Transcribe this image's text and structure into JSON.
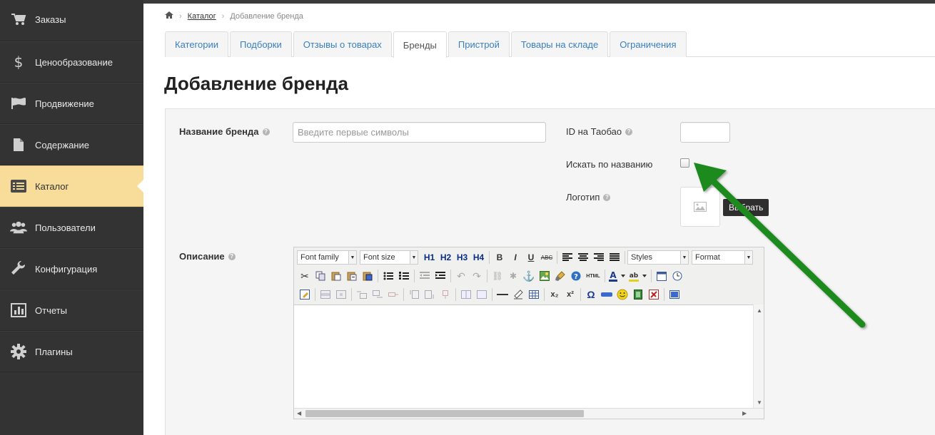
{
  "sidebar": {
    "items": [
      {
        "label": "Заказы",
        "icon": "cart-icon",
        "active": false
      },
      {
        "label": "Ценообразование",
        "icon": "dollar-icon",
        "active": false
      },
      {
        "label": "Продвижение",
        "icon": "flag-icon",
        "active": false
      },
      {
        "label": "Содержание",
        "icon": "document-icon",
        "active": false
      },
      {
        "label": "Каталог",
        "icon": "catalog-list-icon",
        "active": true
      },
      {
        "label": "Пользователи",
        "icon": "users-icon",
        "active": false
      },
      {
        "label": "Конфигурация",
        "icon": "wrench-icon",
        "active": false
      },
      {
        "label": "Отчеты",
        "icon": "bar-chart-icon",
        "active": false
      },
      {
        "label": "Плагины",
        "icon": "gear-icon",
        "active": false
      }
    ]
  },
  "breadcrumb": {
    "home_icon": "home-icon",
    "link": "Каталог",
    "current": "Добавление бренда"
  },
  "tabs": [
    {
      "label": "Категории",
      "active": false
    },
    {
      "label": "Подборки",
      "active": false
    },
    {
      "label": "Отзывы о товарах",
      "active": false
    },
    {
      "label": "Бренды",
      "active": true
    },
    {
      "label": "Пристрой",
      "active": false
    },
    {
      "label": "Товары на складе",
      "active": false
    },
    {
      "label": "Ограничения",
      "active": false
    }
  ],
  "page": {
    "title": "Добавление бренда"
  },
  "form": {
    "brand_name_label": "Название бренда",
    "brand_name_placeholder": "Введите первые символы",
    "brand_name_value": "",
    "taobao_id_label": "ID на Таобао",
    "taobao_id_value": "",
    "search_by_name_label": "Искать по названию",
    "search_by_name_checked": false,
    "logo_label": "Логотип",
    "choose_button": "Выбрать",
    "description_label": "Описание",
    "help_glyph": "?"
  },
  "editor": {
    "font_family": "Font family",
    "font_size": "Font size",
    "styles": "Styles",
    "format": "Format",
    "h1": "H1",
    "h2": "H2",
    "h3": "H3",
    "h4": "H4",
    "bold": "B",
    "italic": "I",
    "underline": "U",
    "strike": "ABC",
    "html": "HTML",
    "subscript": "x₂",
    "superscript": "x²",
    "omega": "Ω",
    "content": ""
  },
  "annotation": {
    "color": "#1f8a1f"
  },
  "colors": {
    "sidebar_bg": "#333333",
    "active_nav": "#f7dc9a",
    "tab_link": "#3a7fc1"
  }
}
